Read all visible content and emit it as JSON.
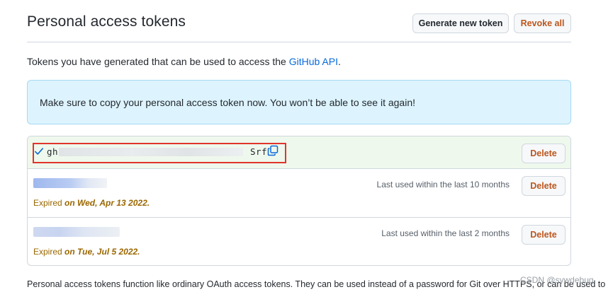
{
  "header": {
    "title": "Personal access tokens",
    "generate_label": "Generate new token",
    "revoke_label": "Revoke all"
  },
  "intro": {
    "prefix": "Tokens you have generated that can be used to access the ",
    "link_text": "GitHub API",
    "suffix": "."
  },
  "flash": {
    "message": "Make sure to copy your personal access token now. You won’t be able to see it again!"
  },
  "tokens": {
    "new_token": {
      "value_start": "gh",
      "value_end": "Srf",
      "delete_label": "Delete"
    },
    "items": [
      {
        "last_used": "Last used within the last 10 months",
        "expired_prefix": "Expired",
        "expired_date": "on Wed, Apr 13 2022.",
        "delete_label": "Delete"
      },
      {
        "last_used": "Last used within the last 2 months",
        "expired_prefix": "Expired",
        "expired_date": "on Tue, Jul 5 2022.",
        "delete_label": "Delete"
      }
    ]
  },
  "footer": {
    "text": "Personal access tokens function like ordinary OAuth access tokens. They can be used instead of a password for Git over HTTPS, or can be used to"
  },
  "watermark": "CSDN @sywdebug",
  "colors": {
    "link": "#0969da",
    "danger": "#bd561d",
    "flash_bg": "#ddf4ff",
    "new_token_bg": "#eff8ec",
    "highlight": "#e0352b"
  }
}
